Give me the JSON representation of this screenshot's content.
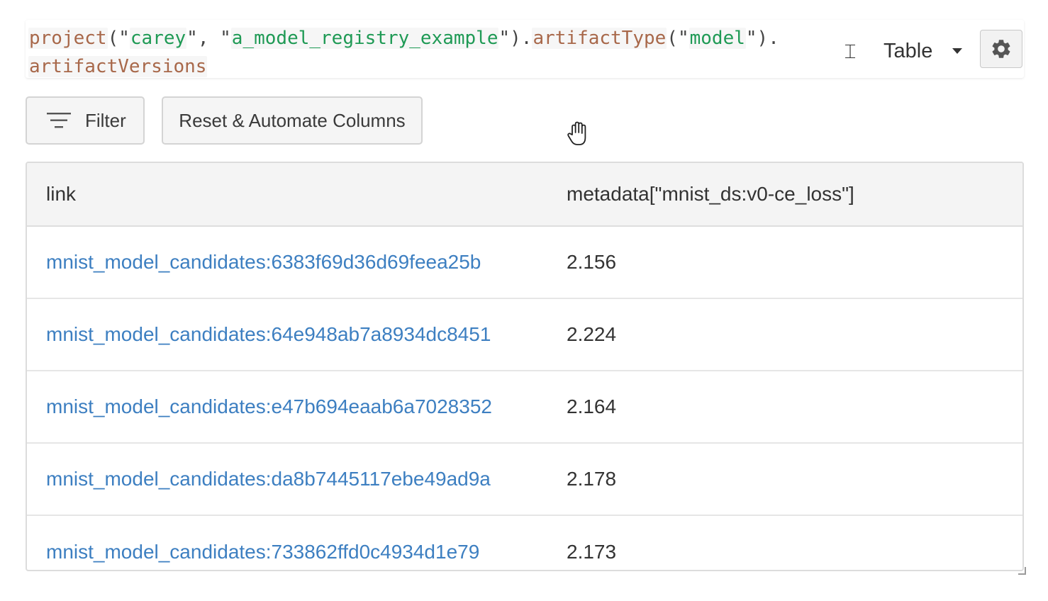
{
  "expression": {
    "tokens": [
      {
        "kind": "fn",
        "text": "project"
      },
      {
        "kind": "punct",
        "text": "(\""
      },
      {
        "kind": "str",
        "text": "carey"
      },
      {
        "kind": "punct",
        "text": "\", \""
      },
      {
        "kind": "str",
        "text": "a_model_registry_example"
      },
      {
        "kind": "punct",
        "text": "\")."
      },
      {
        "kind": "fn",
        "text": "artifactType"
      },
      {
        "kind": "punct",
        "text": "(\""
      },
      {
        "kind": "str",
        "text": "model"
      },
      {
        "kind": "punct",
        "text": "\")."
      },
      {
        "kind": "fn",
        "text": "artifactVersions"
      }
    ]
  },
  "panel_type": {
    "selected": "Table"
  },
  "toolbar": {
    "filter_label": "Filter",
    "reset_label": "Reset & Automate Columns"
  },
  "table": {
    "columns": [
      "link",
      "metadata[\"mnist_ds:v0-ce_loss\"]"
    ],
    "rows": [
      {
        "link": "mnist_model_candidates:6383f69d36d69feea25b",
        "value": "2.156"
      },
      {
        "link": "mnist_model_candidates:64e948ab7a8934dc8451",
        "value": "2.224"
      },
      {
        "link": "mnist_model_candidates:e47b694eaab6a7028352",
        "value": "2.164"
      },
      {
        "link": "mnist_model_candidates:da8b7445117ebe49ad9a",
        "value": "2.178"
      },
      {
        "link": "mnist_model_candidates:733862ffd0c4934d1e79",
        "value": "2.173"
      }
    ]
  },
  "icons": {
    "text_cursor": "ibeam-cursor-icon",
    "panel_caret": "caret-down-icon",
    "settings": "gear-icon",
    "filter": "filter-lines-icon",
    "pointer": "hand-pointer-icon",
    "resize": "resize-corner-icon"
  },
  "colors": {
    "function_token": "#a8684a",
    "string_token": "#1f9a55",
    "link": "#3d7fc1",
    "header_bg": "#f4f4f4"
  }
}
